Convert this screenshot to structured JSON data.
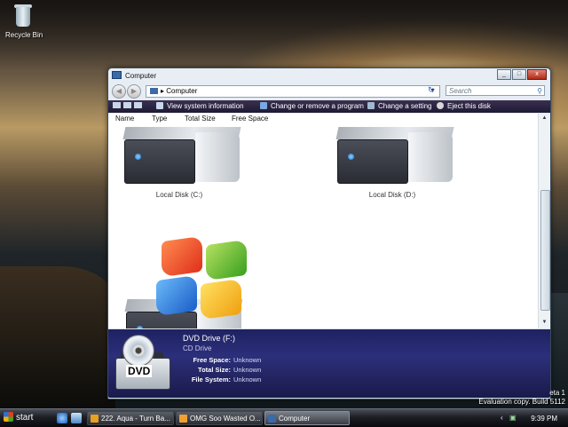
{
  "desktop": {
    "recycle_bin_label": "Recycle Bin"
  },
  "window": {
    "title": "Computer",
    "address": {
      "path": "Computer"
    },
    "search_placeholder": "Search",
    "commands": [
      {
        "label": "View system information"
      },
      {
        "label": "Change or remove a program"
      },
      {
        "label": "Change a setting"
      },
      {
        "label": "Eject this disk"
      }
    ],
    "columns": [
      "Name",
      "Type",
      "Total Size",
      "Free Space"
    ],
    "drives": [
      {
        "label": "Local Disk (C:)"
      },
      {
        "label": "Local Disk (D:)"
      }
    ],
    "details": {
      "name": "DVD Drive (F:)",
      "type": "CD Drive",
      "icon_text": "DVD",
      "free_space_label": "Free Space:",
      "free_space_value": "Unknown",
      "total_size_label": "Total Size:",
      "total_size_value": "Unknown",
      "file_system_label": "File System:",
      "file_system_value": "Unknown"
    }
  },
  "watermark": {
    "beta": "eta 1",
    "eval": "Evaluation copy. Build 5112"
  },
  "taskbar": {
    "start_label": "start",
    "buttons": [
      {
        "label": "222. Aqua - Turn Ba..."
      },
      {
        "label": "OMG Soo Wasted O..."
      },
      {
        "label": "Computer"
      }
    ],
    "clock": "9:39 PM"
  },
  "colors": {
    "command_bar": "#1e1a34",
    "details_pane": "#2c2f7a",
    "taskbar": "#1c1e24"
  }
}
